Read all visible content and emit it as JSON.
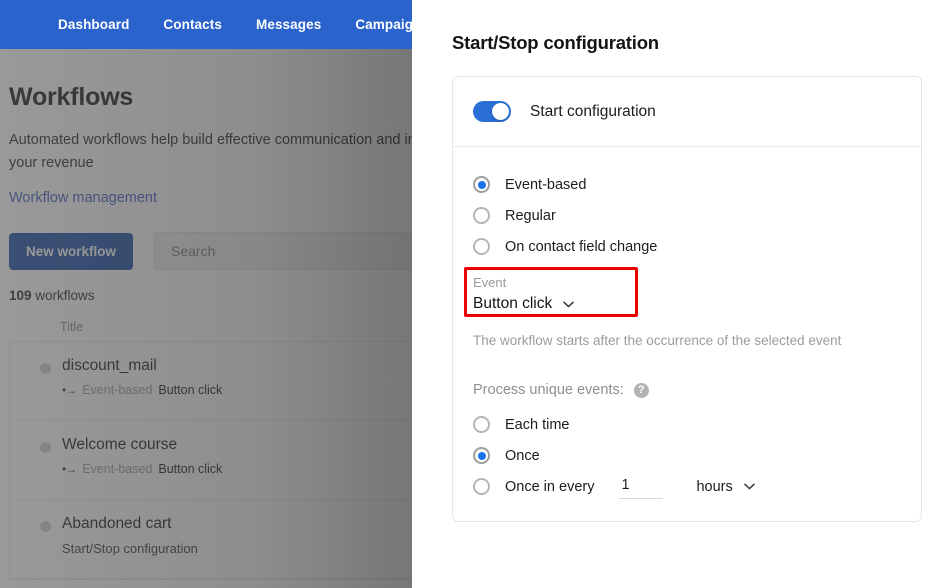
{
  "left_app": {
    "nav": [
      {
        "label": "Dashboard"
      },
      {
        "label": "Contacts"
      },
      {
        "label": "Messages"
      },
      {
        "label": "Campaigns"
      }
    ],
    "page_title": "Workflows",
    "description": "Automated workflows help build effective communication and increase your revenue",
    "link_label": "Workflow management",
    "new_workflow_button": "New workflow",
    "search_placeholder": "Search",
    "count_number": "109",
    "count_word": "workflows",
    "column_header_title": "Title",
    "trigger_icon_glyph": "•→",
    "workflows": [
      {
        "name": "discount_mail",
        "trigger_type": "Event-based",
        "trigger_event": "Button click"
      },
      {
        "name": "Welcome course",
        "trigger_type": "Event-based",
        "trigger_event": "Button click"
      },
      {
        "name": "Abandoned cart",
        "subtitle": "Start/Stop configuration"
      }
    ]
  },
  "panel": {
    "title": "Start/Stop configuration",
    "toggle_label": "Start configuration",
    "toggle_on": true,
    "start_type_options": [
      {
        "label": "Event-based",
        "selected": true
      },
      {
        "label": "Regular",
        "selected": false
      },
      {
        "label": "On contact field change",
        "selected": false
      }
    ],
    "event_field": {
      "label": "Event",
      "value": "Button click",
      "highlighted": true,
      "highlight_color": "#ee0000"
    },
    "event_hint": "The workflow starts after the occurrence of the selected event",
    "unique_events": {
      "label": "Process unique events:",
      "help_icon": "?",
      "options": [
        {
          "label": "Each time",
          "selected": false
        },
        {
          "label": "Once",
          "selected": true
        },
        {
          "label": "Once in every",
          "selected": false
        }
      ],
      "interval_value": "1",
      "interval_unit": "hours"
    }
  },
  "colors": {
    "nav_blue": "#2b63cd",
    "button_blue": "#1f4fa8",
    "accent_blue": "#1a73e8",
    "toggle_blue": "#2b6fd6",
    "link_blue": "#3d5fc4",
    "highlight_red": "#ee0000"
  }
}
